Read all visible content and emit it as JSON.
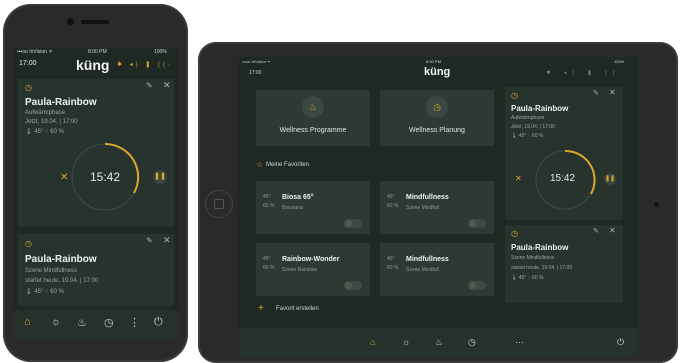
{
  "phone": {
    "status": {
      "carrier": "•••oo InVision ᯤ",
      "time": "8:00 PM",
      "battery": "100%"
    },
    "header": {
      "time": "17:00",
      "logo": "küng",
      "icons": "✱ ◂) ❚ ((·"
    },
    "card1": {
      "title": "Paula-Rainbow",
      "phase": "Aufwärmphase",
      "start": "Jetzt, 19.04. | 17:00",
      "stats": "🌡 45°  ◌ 60 %",
      "timer": "15:42"
    },
    "card2": {
      "title": "Paula-Rainbow",
      "phase": "Szene Mindfullness",
      "start": "startet heute, 19.04. | 17:00",
      "stats": "🌡 45°  ◌ 60 %"
    },
    "nav": [
      "⌂",
      "☼",
      "♨",
      "◷",
      "⋮",
      "⏻"
    ]
  },
  "tablet": {
    "status": {
      "carrier": "•••oo InVision ᯤ",
      "time": "8:00 PM",
      "battery": "100%"
    },
    "header": {
      "time": "17:00",
      "logo": "küng",
      "icons": "✱ ◂) ❚ ((·"
    },
    "tiles": [
      {
        "label": "Wellness Programme",
        "icon": "♨"
      },
      {
        "label": "Wellness Planung",
        "icon": "◷"
      }
    ],
    "favorites_heading": "Meine Favoriten",
    "favorites": [
      {
        "temp": "45°",
        "hum": "60 %",
        "name": "Biosa 65°",
        "desc": "Biosauna"
      },
      {
        "temp": "45°",
        "hum": "60 %",
        "name": "Mindfullness",
        "desc": "Szene Mindfull"
      },
      {
        "temp": "45°",
        "hum": "60 %",
        "name": "Rainbow-Wonder",
        "desc": "Szene Rainbow"
      },
      {
        "temp": "45°",
        "hum": "60 %",
        "name": "Mindfullness",
        "desc": "Szene Mindfull"
      }
    ],
    "add_favorite": "Favorit erstellen",
    "card1": {
      "title": "Paula-Rainbow",
      "phase": "Aufwärmphase",
      "start": "Jetzt, 19.04. | 17:00",
      "stats": "🌡 45°  ◌ 60 %",
      "timer": "15:42"
    },
    "card2": {
      "title": "Paula-Rainbow",
      "phase": "Szene Mindfullness",
      "start": "startet heute, 19.04. | 17:00",
      "stats": "🌡 45°  ◌ 60 %"
    },
    "nav": [
      "⌂",
      "☼",
      "♨",
      "◷",
      "···",
      "⏻"
    ]
  },
  "colors": {
    "accent": "#d9a72d",
    "background": "#1f2924",
    "card": "#27332d"
  },
  "timer_progress": 0.35
}
